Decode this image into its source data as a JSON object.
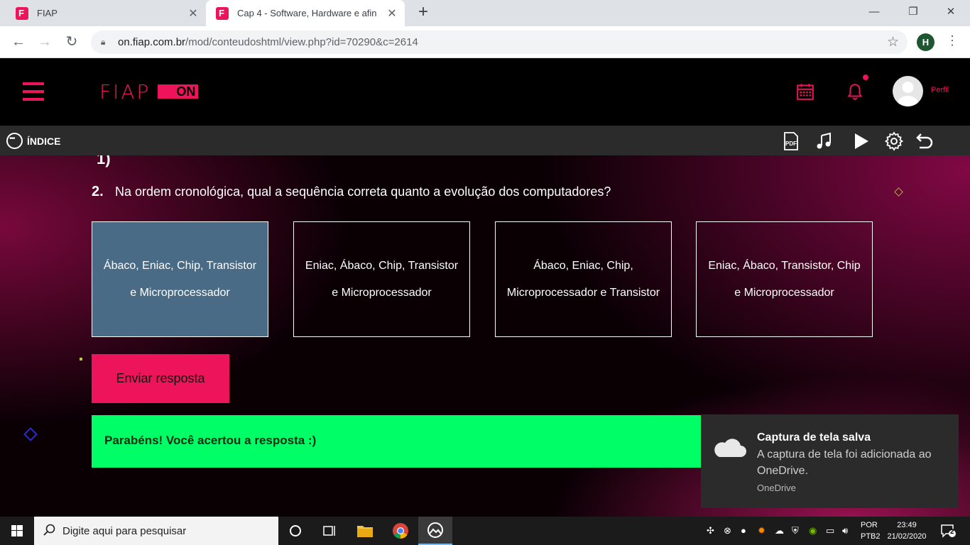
{
  "browser": {
    "tabs": [
      {
        "title": "FIAP",
        "active": false
      },
      {
        "title": "Cap 4 - Software, Hardware e afin",
        "active": true
      }
    ],
    "url_host": "on.fiap.com.br",
    "url_path": "/mod/conteudoshtml/view.php?id=70290&c=2614",
    "profile_initial": "H"
  },
  "header": {
    "logo_text": "FIAP",
    "logo_badge": "ON",
    "profile_label": "Perfil"
  },
  "subbar": {
    "indice_label": "ÍNDICE"
  },
  "question": {
    "previous_number_fragment": "1)",
    "number": "2.",
    "text": "Na ordem cronológica, qual a sequência correta quanto a evolução dos computadores?",
    "options": [
      {
        "text": "Ábaco, Eniac, Chip, Transistor e Microprocessador",
        "selected": true
      },
      {
        "text": "Eniac, Ábaco, Chip, Transistor e Microprocessador",
        "selected": false
      },
      {
        "text": "Ábaco, Eniac, Chip, Microprocessador e Transistor",
        "selected": false
      },
      {
        "text": "Eniac, Ábaco, Transistor, Chip e Microprocessador",
        "selected": false
      }
    ],
    "send_label": "Enviar resposta",
    "feedback": "Parabéns! Você acertou a resposta :)"
  },
  "toast": {
    "title": "Captura de tela salva",
    "body": "A captura de tela foi adicionada ao OneDrive.",
    "source": "OneDrive"
  },
  "taskbar": {
    "search_placeholder": "Digite aqui para pesquisar",
    "lang_top": "POR",
    "lang_bottom": "PTB2",
    "time": "23:49",
    "date": "21/02/2020",
    "notifications": "2"
  },
  "colors": {
    "brand": "#ed145b",
    "selected_option": "#4a6b85",
    "success": "#00ff66"
  }
}
